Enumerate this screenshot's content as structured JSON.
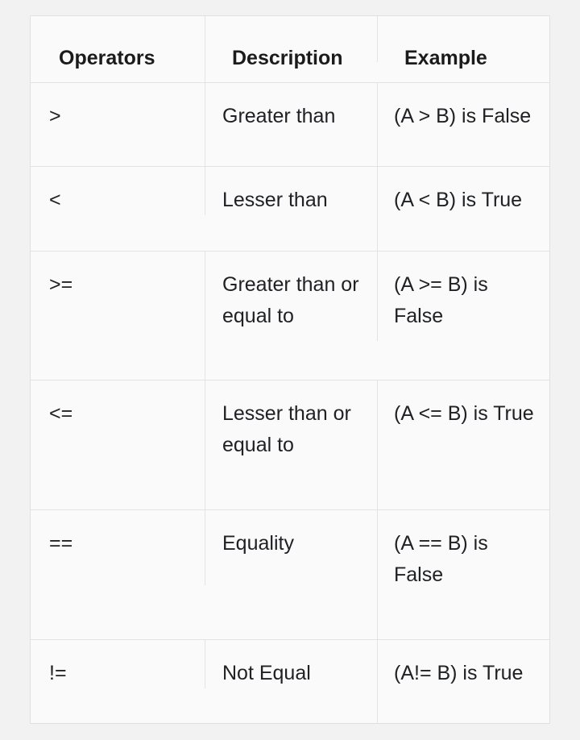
{
  "table": {
    "name": "relational-operators-table",
    "columns": [
      {
        "key": "operators",
        "label": "Operators"
      },
      {
        "key": "description",
        "label": "Description"
      },
      {
        "key": "example",
        "label": "Example"
      }
    ],
    "rows": [
      {
        "operator": ">",
        "description": "Greater than",
        "example": "(A > B) is False"
      },
      {
        "operator": "<",
        "description": "Lesser than",
        "example": "(A < B) is True"
      },
      {
        "operator": ">=",
        "description": "Greater than or equal to",
        "example": "(A >= B) is False"
      },
      {
        "operator": "<=",
        "description": "Lesser than or equal to",
        "example": "(A <= B) is True"
      },
      {
        "operator": "==",
        "description": "Equality",
        "example": "(A == B) is False"
      },
      {
        "operator": "!=",
        "description": "Not Equal",
        "example": "(A!= B) is True"
      }
    ]
  },
  "colors": {
    "page_background": "#f2f2f2",
    "cell_background": "#fafafa",
    "border": "#e3e3e3",
    "text": "#202124",
    "header_text": "#1b1b1b"
  }
}
